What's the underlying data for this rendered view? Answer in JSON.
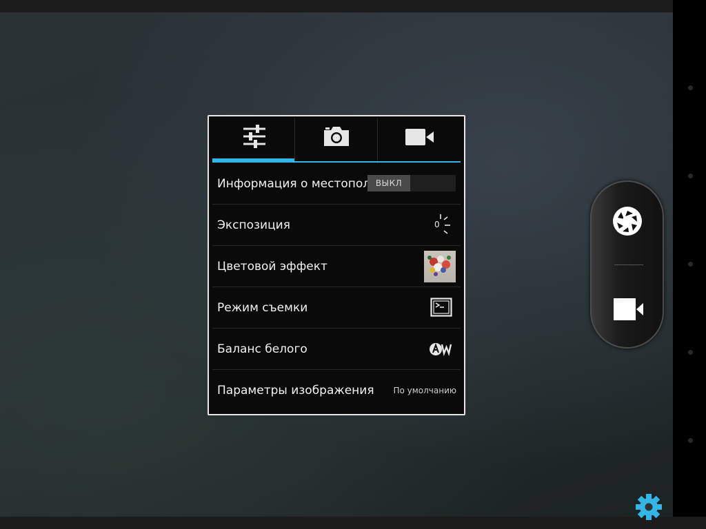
{
  "camera_settings": {
    "tabs": [
      {
        "name": "general-settings",
        "icon": "sliders-icon",
        "active": true
      },
      {
        "name": "photo-settings",
        "icon": "camera-icon",
        "active": false
      },
      {
        "name": "video-settings",
        "icon": "video-icon",
        "active": false
      }
    ],
    "rows": [
      {
        "label": "Информация о местоположении",
        "control": "toggle",
        "toggle_text": "ВЫКЛ"
      },
      {
        "label": "Экспозиция",
        "icon": "exposure-icon",
        "value": "0"
      },
      {
        "label": "Цветовой эффект",
        "icon": "color-effect-thumbnail"
      },
      {
        "label": "Режим съемки",
        "icon": "scene-mode-icon"
      },
      {
        "label": "Баланс белого",
        "icon": "auto-white-balance-icon"
      },
      {
        "label": "Параметры изображения",
        "value": "По умолчанию"
      }
    ]
  },
  "mode_switcher": {
    "photo_icon": "shutter-icon",
    "video_icon": "video-icon"
  },
  "settings_button": {
    "icon": "gear-icon",
    "color": "#33b5e5"
  },
  "colors": {
    "accent": "#33b5e5"
  }
}
